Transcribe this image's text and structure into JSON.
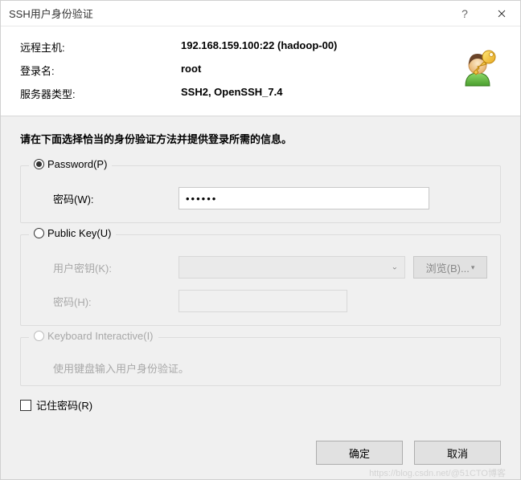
{
  "titlebar": {
    "title": "SSH用户身份验证"
  },
  "header": {
    "remote_host_label": "远程主机:",
    "remote_host_value": "192.168.159.100:22 (hadoop-00)",
    "login_label": "登录名:",
    "login_value": "root",
    "server_type_label": "服务器类型:",
    "server_type_value": "SSH2, OpenSSH_7.4"
  },
  "instruction": "请在下面选择恰当的身份验证方法并提供登录所需的信息。",
  "password_group": {
    "title": "Password(P)",
    "password_label": "密码(W):",
    "password_value": "••••••"
  },
  "publickey_group": {
    "title": "Public Key(U)",
    "userkey_label": "用户密钥(K):",
    "browse_label": "浏览(B)...",
    "password_label": "密码(H):"
  },
  "keyboard_group": {
    "title": "Keyboard Interactive(I)",
    "hint": "使用键盘输入用户身份验证。"
  },
  "remember": {
    "label": "记住密码(R)"
  },
  "buttons": {
    "ok": "确定",
    "cancel": "取消"
  },
  "watermark": "https://blog.csdn.net/@51CTO博客"
}
